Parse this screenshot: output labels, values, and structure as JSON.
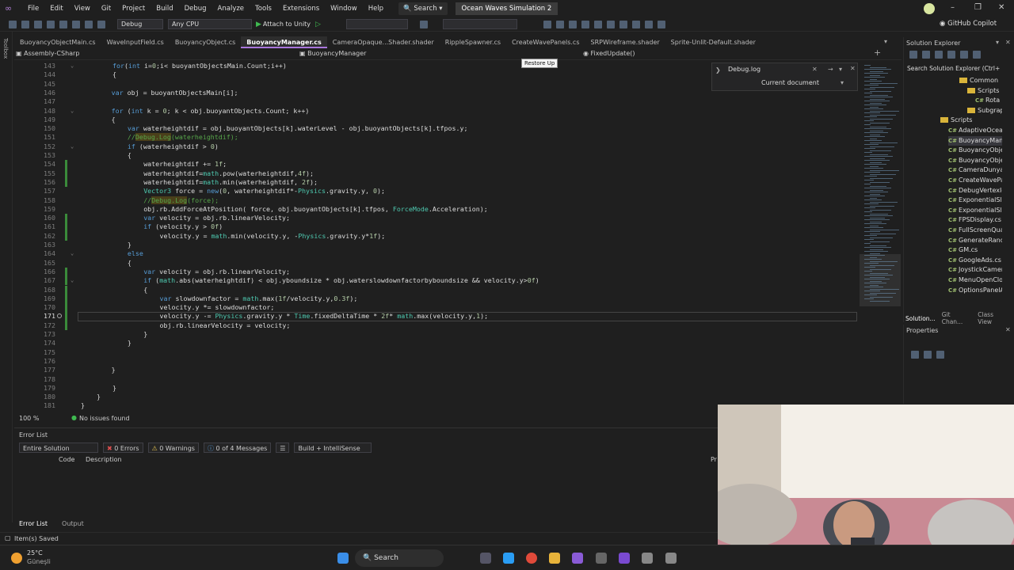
{
  "menubar": {
    "items": [
      "File",
      "Edit",
      "View",
      "Git",
      "Project",
      "Build",
      "Debug",
      "Analyze",
      "Tools",
      "Extensions",
      "Window",
      "Help"
    ],
    "search_label": "Search",
    "solution_name": "Ocean Waves Simulation 2"
  },
  "toolbar": {
    "config": "Debug",
    "platform": "Any CPU",
    "attach_label": "Attach to Unity",
    "copilot_label": "GitHub Copilot"
  },
  "tabs": [
    {
      "label": "BuoyancyObjectMain.cs"
    },
    {
      "label": "WaveInputField.cs"
    },
    {
      "label": "BuoyancyObject.cs"
    },
    {
      "label": "BuoyancyManager.cs"
    },
    {
      "label": "CameraOpaque...Shader.shader"
    },
    {
      "label": "RippleSpawner.cs"
    },
    {
      "label": "CreateWavePanels.cs"
    },
    {
      "label": "SRPWireframe.shader"
    },
    {
      "label": "Sprite-Unlit-Default.shader"
    }
  ],
  "navbar": {
    "project": "Assembly-CSharp",
    "class": "BuoyancyManager",
    "method": "FixedUpdate()",
    "restore_tooltip": "Restore Up"
  },
  "find": {
    "query": "Debug.log",
    "scope": "Current document"
  },
  "editor": {
    "lines": [
      {
        "n": "143",
        "code": "for(int i=0;i< buoyantObjectsMain.Count;i++)"
      },
      {
        "n": "144",
        "code": "{"
      },
      {
        "n": "145",
        "code": ""
      },
      {
        "n": "146",
        "code": "var obj = buoyantObjectsMain[i];"
      },
      {
        "n": "147",
        "code": ""
      },
      {
        "n": "148",
        "code": "for (int k = 0; k < obj.buoyantObjects.Count; k++)"
      },
      {
        "n": "149",
        "code": "{"
      },
      {
        "n": "150",
        "code": "var waterheightdif = obj.buoyantObjects[k].waterLevel - obj.buoyantObjects[k].tfpos.y;"
      },
      {
        "n": "151",
        "code": "//Debug.Log(waterheightdif);"
      },
      {
        "n": "152",
        "code": "if (waterheightdif > 0)"
      },
      {
        "n": "153",
        "code": "{"
      },
      {
        "n": "154",
        "code": "waterheightdif += 1f;"
      },
      {
        "n": "155",
        "code": "waterheightdif=math.pow(waterheightdif,4f);"
      },
      {
        "n": "156",
        "code": "waterheightdif=math.min(waterheightdif, 2f);"
      },
      {
        "n": "157",
        "code": "Vector3 force = new(0, waterheightdif*-Physics.gravity.y, 0);"
      },
      {
        "n": "158",
        "code": "//Debug.Log(force);"
      },
      {
        "n": "159",
        "code": "obj.rb.AddForceAtPosition( force, obj.buoyantObjects[k].tfpos, ForceMode.Acceleration);"
      },
      {
        "n": "160",
        "code": "var velocity = obj.rb.linearVelocity;"
      },
      {
        "n": "161",
        "code": "if (velocity.y > 0f)"
      },
      {
        "n": "162",
        "code": "velocity.y = math.min(velocity.y, -Physics.gravity.y*1f);"
      },
      {
        "n": "163",
        "code": "}"
      },
      {
        "n": "164",
        "code": "else"
      },
      {
        "n": "165",
        "code": "{"
      },
      {
        "n": "166",
        "code": "var velocity = obj.rb.linearVelocity;"
      },
      {
        "n": "167",
        "code": "if (math.abs(waterheightdif) < obj.yboundsize * obj.waterslowdownfactorbyboundsize && velocity.y>0f)"
      },
      {
        "n": "168",
        "code": "{"
      },
      {
        "n": "169",
        "code": "var slowdownfactor = math.max(1f/velocity.y,0.3f);"
      },
      {
        "n": "170",
        "code": "velocity.y *= slowdownfactor;"
      },
      {
        "n": "171",
        "code": "velocity.y -= Physics.gravity.y * Time.fixedDeltaTime * 2f* math.max(velocity.y,1);"
      },
      {
        "n": "172",
        "code": "obj.rb.linearVelocity = velocity;"
      },
      {
        "n": "173",
        "code": "}"
      },
      {
        "n": "174",
        "code": "}"
      },
      {
        "n": "175",
        "code": ""
      },
      {
        "n": "176",
        "code": ""
      },
      {
        "n": "177",
        "code": "}"
      },
      {
        "n": "178",
        "code": ""
      },
      {
        "n": "179",
        "code": "}"
      },
      {
        "n": "180",
        "code": "}"
      },
      {
        "n": "181",
        "code": "}"
      }
    ],
    "zoom": "100 %",
    "issues": "No issues found"
  },
  "errorlist": {
    "title": "Error List",
    "scope": "Entire Solution",
    "errors": "0 Errors",
    "warnings": "0 Warnings",
    "messages": "0 of 4 Messages",
    "build_filter": "Build + IntelliSense",
    "col_code": "Code",
    "col_description": "Description",
    "col_pr": "Pr"
  },
  "bottomtabs": [
    "Error List",
    "Output"
  ],
  "statusbar": {
    "saved": "Item(s) Saved"
  },
  "solution_explorer": {
    "title": "Solution Explorer",
    "search_placeholder": "Search Solution Explorer (Ctrl+",
    "items": [
      {
        "label": "Common",
        "kind": "folder"
      },
      {
        "label": "Scripts",
        "kind": "folder"
      },
      {
        "label": "Rota",
        "kind": "cs"
      },
      {
        "label": "Subgrap",
        "kind": "folder"
      },
      {
        "label": "Scripts",
        "kind": "folder"
      },
      {
        "label": "AdaptiveOcear",
        "kind": "cs"
      },
      {
        "label": "BuoyancyMana",
        "kind": "cs"
      },
      {
        "label": "BuoyancyObje",
        "kind": "cs"
      },
      {
        "label": "BuoyancyObje",
        "kind": "cs"
      },
      {
        "label": "CameraDunyab",
        "kind": "cs"
      },
      {
        "label": "CreateWavePar",
        "kind": "cs"
      },
      {
        "label": "DebugVertexId.",
        "kind": "cs"
      },
      {
        "label": "ExponentialSlid",
        "kind": "cs"
      },
      {
        "label": "ExponentialSlid",
        "kind": "cs"
      },
      {
        "label": "FPSDisplay.cs",
        "kind": "cs"
      },
      {
        "label": "FullScreenQua",
        "kind": "cs"
      },
      {
        "label": "GenerateRanda",
        "kind": "cs"
      },
      {
        "label": "GM.cs",
        "kind": "cs"
      },
      {
        "label": "GoogleAds.cs",
        "kind": "cs"
      },
      {
        "label": "JoystickCamer",
        "kind": "cs"
      },
      {
        "label": "MenuOpenClo",
        "kind": "cs"
      },
      {
        "label": "OptionsPanelA",
        "kind": "cs"
      }
    ],
    "bottom_tabs": [
      "Solution...",
      "Git Chan...",
      "Class View"
    ]
  },
  "properties": {
    "title": "Properties"
  },
  "taskbar": {
    "weather_temp": "25°C",
    "weather_text": "Güneşli",
    "search_label": "Search"
  },
  "colors": {
    "accent": "#a976dc",
    "editor_bg": "#1f1f1f",
    "green_change": "#3a8a3a"
  }
}
